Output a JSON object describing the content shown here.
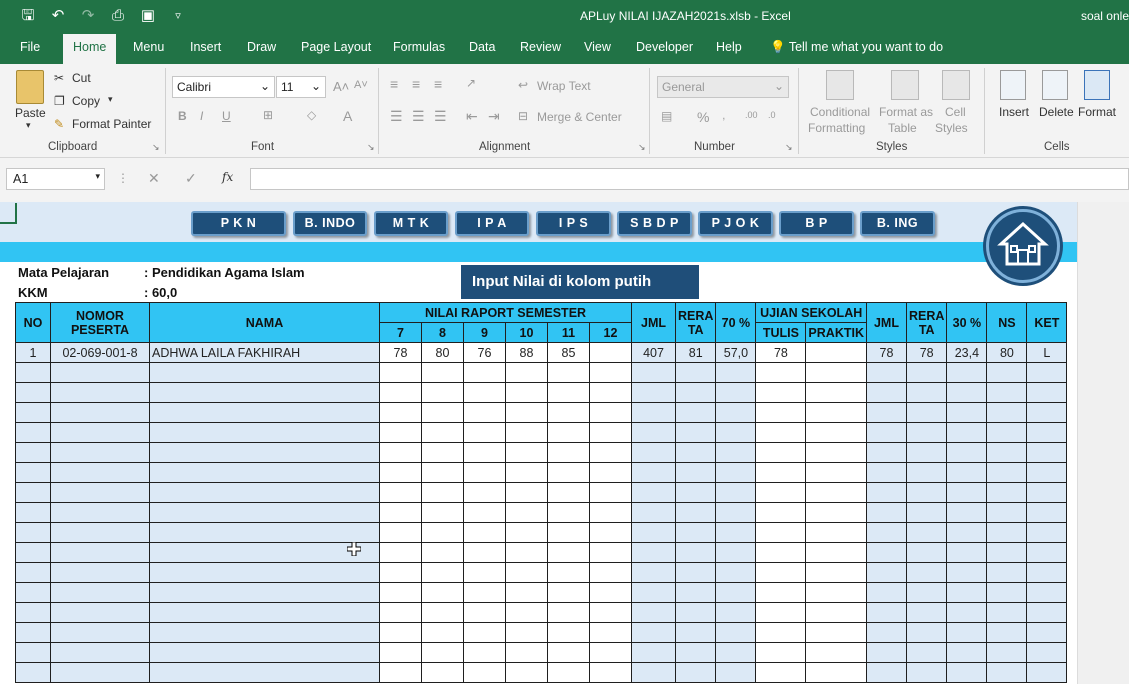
{
  "window": {
    "title": "APLuy NILAI IJAZAH2021s.xlsb  -  Excel",
    "user": "soal onle"
  },
  "quick_access": [
    "save-icon",
    "undo-icon",
    "redo-icon",
    "print-preview-icon",
    "camera-icon",
    "customize-icon"
  ],
  "tabs": [
    "File",
    "Home",
    "Menu",
    "Insert",
    "Draw",
    "Page Layout",
    "Formulas",
    "Data",
    "Review",
    "View",
    "Developer",
    "Help"
  ],
  "tell_me": "Tell me what you want to do",
  "ribbon": {
    "clipboard": {
      "label": "Clipboard",
      "paste": "Paste",
      "cut": "Cut",
      "copy": "Copy",
      "format_painter": "Format Painter"
    },
    "font": {
      "label": "Font",
      "name": "Calibri",
      "size": "11"
    },
    "alignment": {
      "label": "Alignment",
      "wrap": "Wrap Text",
      "merge": "Merge & Center"
    },
    "number": {
      "label": "Number",
      "format": "General"
    },
    "styles": {
      "label": "Styles",
      "conditional": "Conditional",
      "conditional2": "Formatting",
      "format_table": "Format as",
      "format_table2": "Table",
      "cell_styles": "Cell",
      "cell_styles2": "Styles"
    },
    "cells": {
      "label": "Cells",
      "insert": "Insert",
      "delete": "Delete",
      "format": "Format"
    }
  },
  "formula_bar": {
    "name_box": "A1",
    "fx": "fx",
    "value": ""
  },
  "subjects": [
    "P K N",
    "B. INDO",
    "M T K",
    "I P A",
    "I P S",
    "S B D P",
    "P J O K",
    "B P",
    "B. ING"
  ],
  "info": {
    "label1": "Mata Pelajaran",
    "value1": ": Pendidikan Agama Islam",
    "label2": "KKM",
    "value2": ": 60,0"
  },
  "note": "Input Nilai di kolom putih",
  "table": {
    "headers": {
      "no": "NO",
      "nomor1": "NOMOR",
      "nomor2": "PESERTA",
      "nama": "NAMA",
      "raport": "NILAI RAPORT SEMESTER",
      "sem": [
        "7",
        "8",
        "9",
        "10",
        "11",
        "12"
      ],
      "jml": "JML",
      "rerata1": "RERA",
      "rerata2": "TA",
      "pct70": "70 %",
      "ujian": "UJIAN SEKOLAH",
      "tulis": "TULIS",
      "praktik": "PRAKTIK",
      "jml2": "JML",
      "rerata3": "RERA",
      "rerata4": "TA",
      "pct30": "30 %",
      "ns": "NS",
      "ket": "KET"
    },
    "rows": [
      [
        "1",
        "02-069-001-8",
        "ADHWA LAILA FAKHIRAH",
        "78",
        "80",
        "76",
        "88",
        "85",
        "",
        "407",
        "81",
        "57,0",
        "78",
        "",
        "78",
        "78",
        "23,4",
        "80",
        "L"
      ]
    ],
    "empty_rows": 16
  }
}
